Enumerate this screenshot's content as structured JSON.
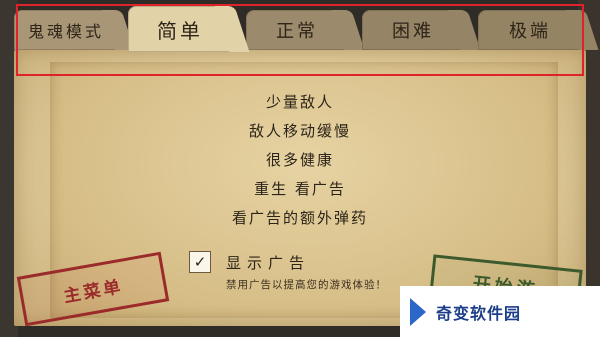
{
  "tabs": {
    "mode_label": "鬼魂模式",
    "items": [
      {
        "label": "简单",
        "selected": true
      },
      {
        "label": "正常",
        "selected": false
      },
      {
        "label": "困难",
        "selected": false
      },
      {
        "label": "极端",
        "selected": false
      }
    ]
  },
  "difficulty_features": [
    "少量敌人",
    "敌人移动缓慢",
    "很多健康",
    "重生 看广告",
    "看广告的额外弹药"
  ],
  "show_ads": {
    "checked": true,
    "label": "显示广告",
    "hint": "禁用广告以提高您的游戏体验！"
  },
  "buttons": {
    "main_menu": "主菜单",
    "start": "开始游"
  },
  "watermark": {
    "text": "奇变软件园"
  },
  "colors": {
    "highlight_border": "#e0222a",
    "selected_tab": "#e2d2a8",
    "main_menu_stamp": "#9b2a2a",
    "start_stamp": "#3c5a2c"
  }
}
